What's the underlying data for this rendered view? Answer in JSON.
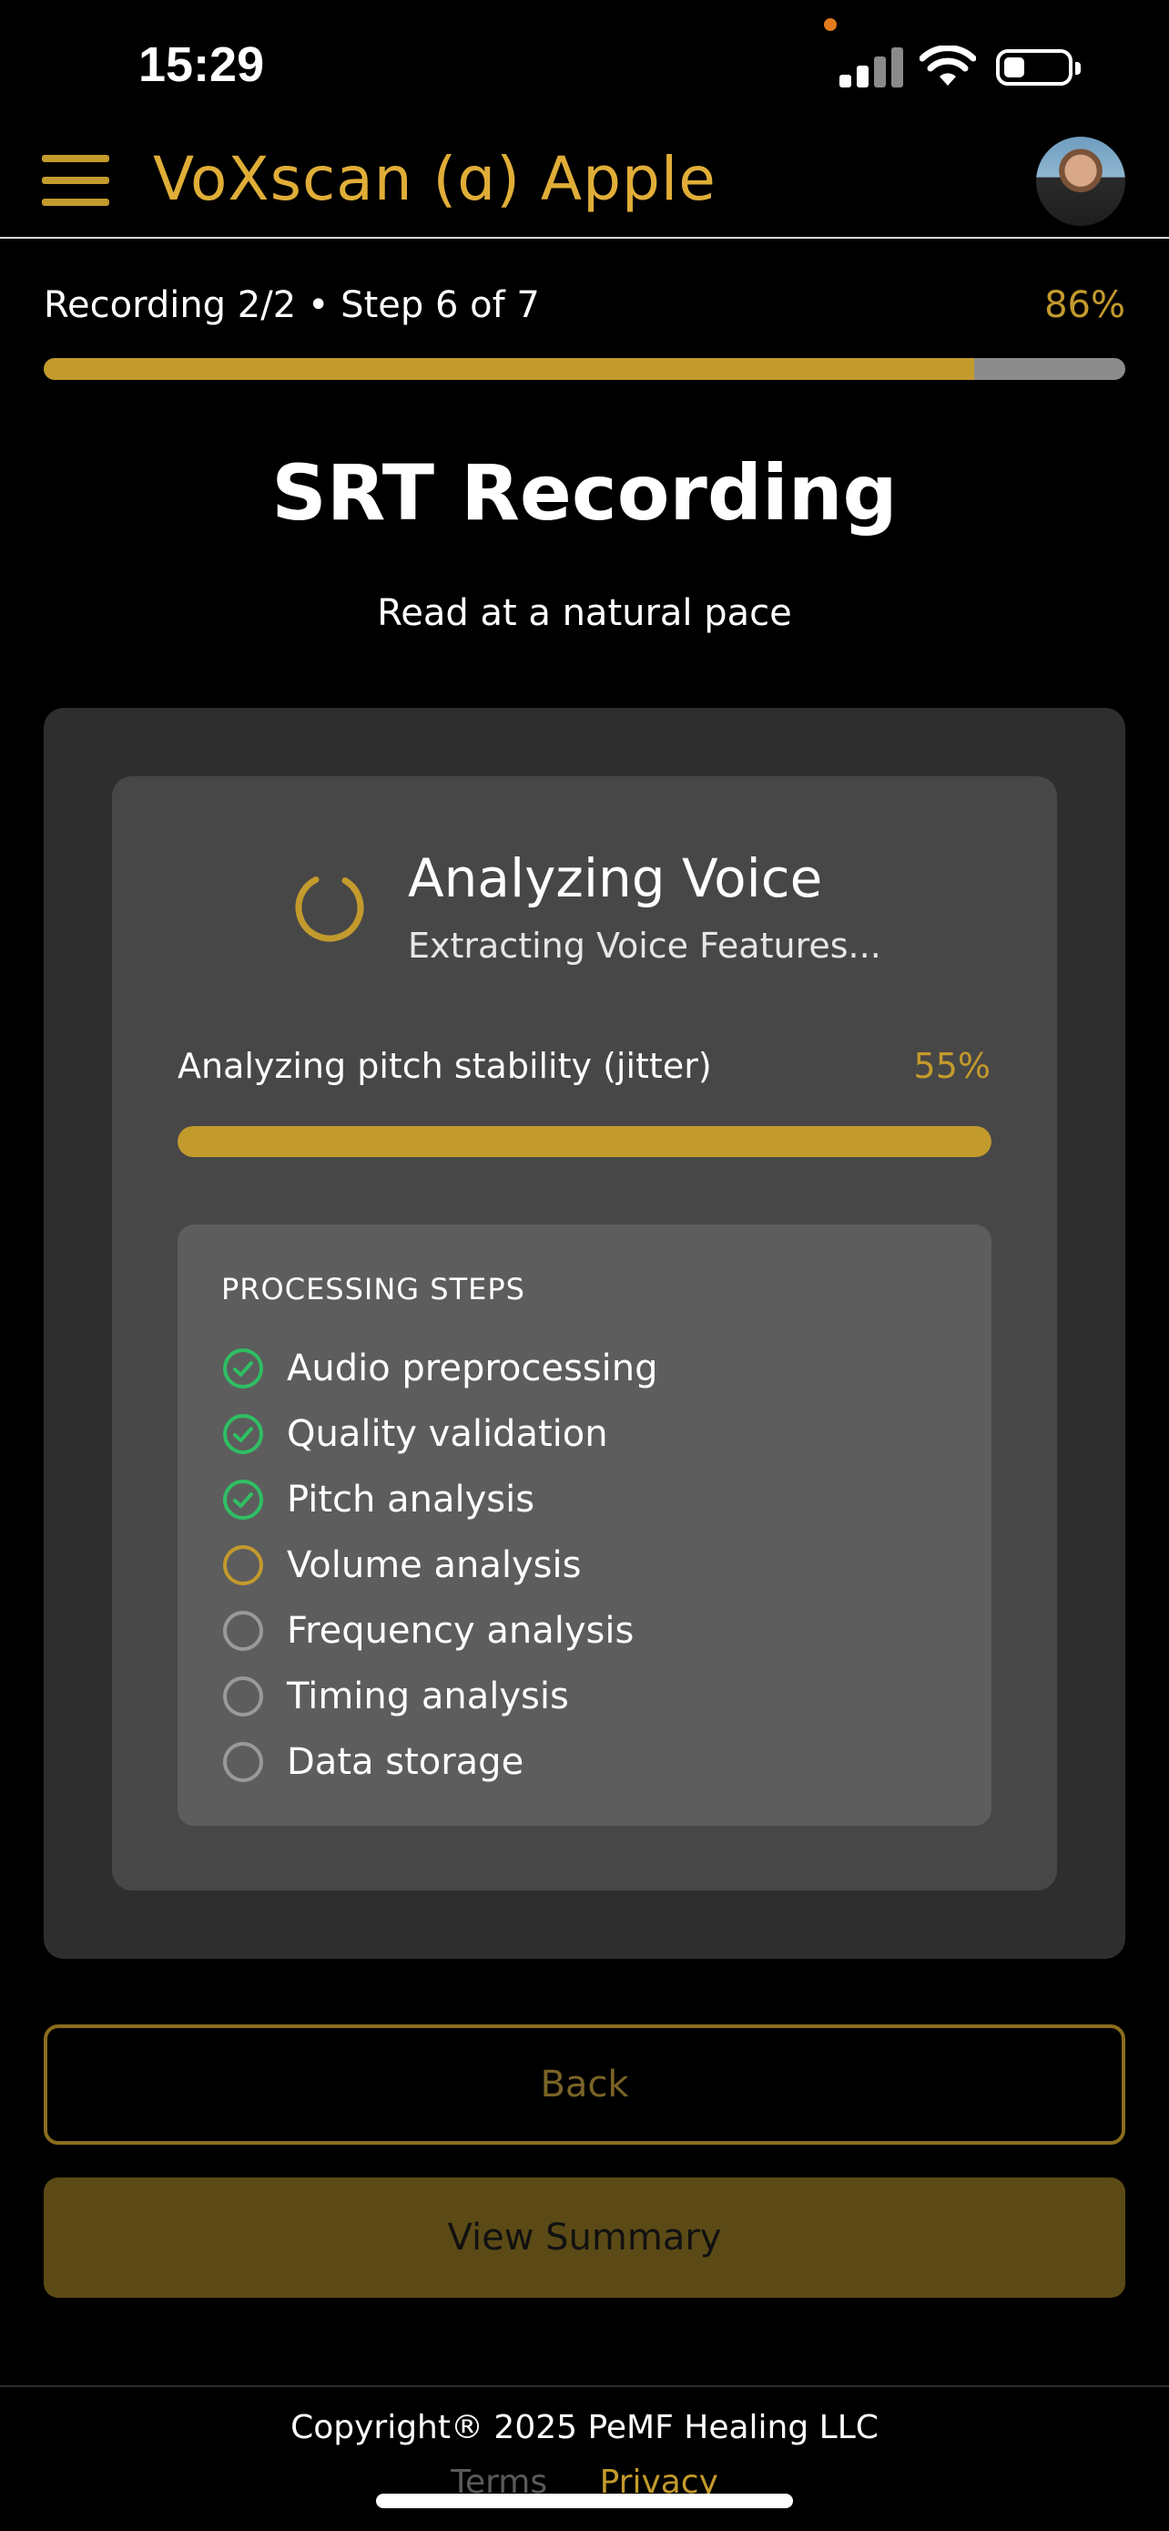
{
  "status_bar": {
    "time": "15:29",
    "battery_level": 0.25,
    "colors": {
      "recording_dot": "#e07a1a"
    }
  },
  "header": {
    "title": "VoXscan (ɑ) Apple",
    "menu_icon": "hamburger-menu-icon",
    "avatar_icon": "user-avatar"
  },
  "progress": {
    "label": "Recording 2/2 • Step 6 of 7",
    "percent_text": "86%",
    "value": 0.86
  },
  "page": {
    "title": "SRT Recording",
    "subtitle": "Read at a natural pace"
  },
  "analysis": {
    "title": "Analyzing Voice",
    "subtitle": "Extracting Voice Features...",
    "task_label": "Analyzing pitch stability (jitter)",
    "task_percent_text": "55%",
    "task_value": 1.0
  },
  "processing": {
    "heading": "PROCESSING STEPS",
    "steps": [
      {
        "label": "Audio preprocessing",
        "status": "done"
      },
      {
        "label": "Quality validation",
        "status": "done"
      },
      {
        "label": "Pitch analysis",
        "status": "done"
      },
      {
        "label": "Volume analysis",
        "status": "active"
      },
      {
        "label": "Frequency analysis",
        "status": "pending"
      },
      {
        "label": "Timing analysis",
        "status": "pending"
      },
      {
        "label": "Data storage",
        "status": "pending"
      }
    ]
  },
  "buttons": {
    "back_label": "Back",
    "summary_label": "View Summary"
  },
  "footer": {
    "copyright": "Copyright® 2025 PeMF Healing LLC",
    "terms_label": "Terms",
    "privacy_label": "Privacy"
  },
  "colors": {
    "accent": "#c39a2c",
    "done": "#2fbf63",
    "pending": "#9a9a9a"
  }
}
